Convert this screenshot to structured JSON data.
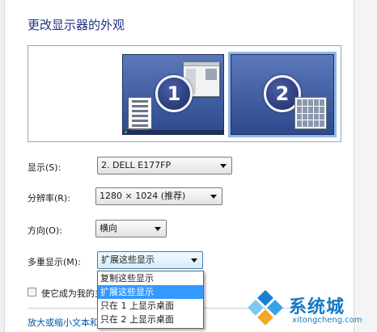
{
  "window": {
    "title": "更改显示器的外观"
  },
  "preview": {
    "monitors": [
      {
        "number": "1"
      },
      {
        "number": "2",
        "selected": true
      }
    ]
  },
  "settings": {
    "display": {
      "label": "显示(S):",
      "value": "2. DELL E177FP"
    },
    "resolution": {
      "label": "分辨率(R):",
      "value": "1280 × 1024 (推荐)"
    },
    "orientation": {
      "label": "方向(O):",
      "value": "横向"
    },
    "multiple_displays": {
      "label": "多重显示(M):",
      "value": "扩展这些显示",
      "options": [
        "复制这些显示",
        "扩展这些显示",
        "只在 1 上显示桌面",
        "只在 2 上显示桌面"
      ],
      "selected_index": 1
    }
  },
  "main_display_checkbox": {
    "label": "使它成为我的主显示器",
    "checked": false
  },
  "text_size_link": "放大或缩小文本和其他项目",
  "watermark": {
    "brand": "系统城",
    "domain": "xitongcheng.com"
  },
  "colors": {
    "title": "#1e3287",
    "link": "#0057a8",
    "selection": "#3399ff",
    "brand": "#1579c4"
  }
}
